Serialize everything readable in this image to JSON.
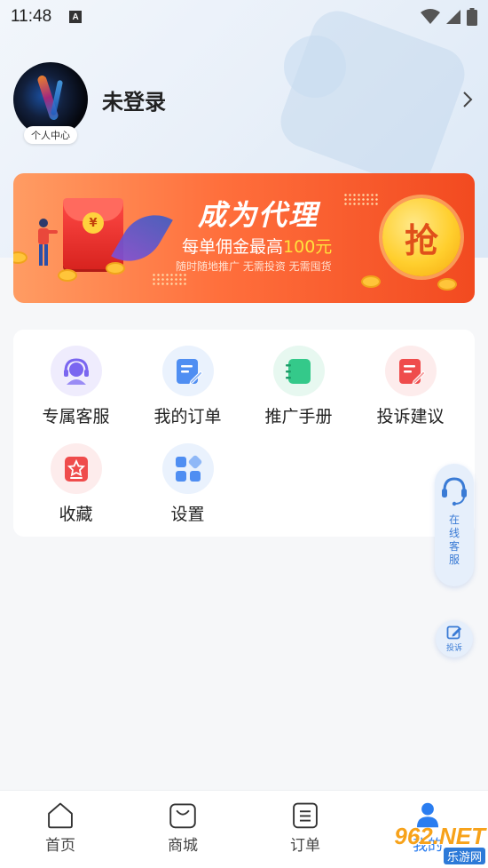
{
  "status_bar": {
    "time": "11:48",
    "notif_letter": "A"
  },
  "profile": {
    "badge": "个人中心",
    "username": "未登录"
  },
  "banner": {
    "title": "成为代理",
    "subtitle_prefix": "每单佣金最高",
    "subtitle_highlight": "100元",
    "desc": "随时随地推广 无需投资 无需囤货",
    "grab": "抢",
    "envelope_symbol": "¥"
  },
  "services": [
    {
      "label": "专属客服",
      "icon": "headset-icon",
      "color": "#7a66f0",
      "bg": "#efecfd"
    },
    {
      "label": "我的订单",
      "icon": "order-doc-icon",
      "color": "#4f8ef2",
      "bg": "#eaf2fd"
    },
    {
      "label": "推广手册",
      "icon": "manual-book-icon",
      "color": "#34c98a",
      "bg": "#e7f8f0"
    },
    {
      "label": "投诉建议",
      "icon": "complaint-doc-icon",
      "color": "#ef4c4c",
      "bg": "#fdecec"
    },
    {
      "label": "收藏",
      "icon": "favorite-star-icon",
      "color": "#ef4c4c",
      "bg": "#fdecec"
    },
    {
      "label": "设置",
      "icon": "settings-grid-icon",
      "color": "#4f8ef2",
      "bg": "#eaf2fd"
    }
  ],
  "float": {
    "customer_service": "在线客服",
    "complaint": "投诉"
  },
  "tabbar": [
    {
      "label": "首页",
      "icon": "home-icon"
    },
    {
      "label": "商城",
      "icon": "shopping-bag-icon"
    },
    {
      "label": "订单",
      "icon": "order-list-icon"
    },
    {
      "label": "我的",
      "icon": "user-icon",
      "active": true
    }
  ],
  "watermark": {
    "number": "962.NET",
    "site": "乐游网"
  },
  "colors": {
    "accent": "#2a7df0",
    "banner_start": "#ff9c63",
    "banner_end": "#f24a20"
  }
}
